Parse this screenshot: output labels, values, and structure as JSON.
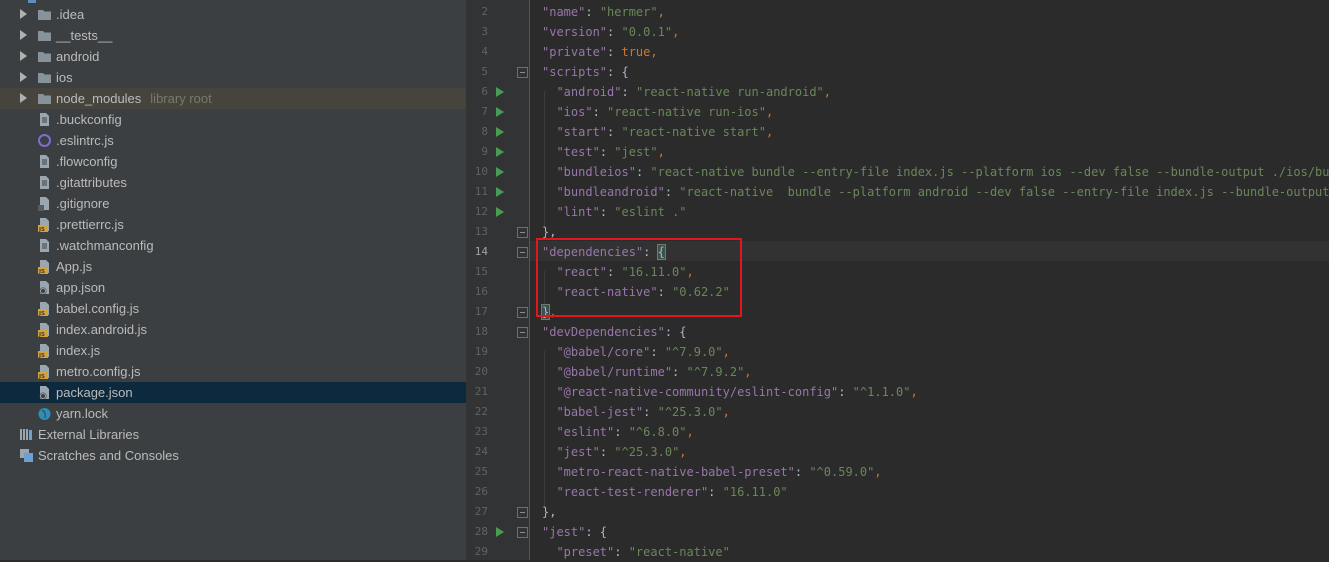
{
  "project_tree": {
    "items": [
      {
        "label": ".idea",
        "kind": "folder",
        "expandable": true
      },
      {
        "label": "__tests__",
        "kind": "folder",
        "expandable": true
      },
      {
        "label": "android",
        "kind": "folder",
        "expandable": true
      },
      {
        "label": "ios",
        "kind": "folder",
        "expandable": true
      },
      {
        "label": "node_modules",
        "hint": "library root",
        "kind": "folder",
        "expandable": true
      },
      {
        "label": ".buckconfig",
        "kind": "text-file"
      },
      {
        "label": ".eslintrc.js",
        "kind": "eslint-file"
      },
      {
        "label": ".flowconfig",
        "kind": "text-file"
      },
      {
        "label": ".gitattributes",
        "kind": "text-file"
      },
      {
        "label": ".gitignore",
        "kind": "git-file"
      },
      {
        "label": ".prettierrc.js",
        "kind": "js-file"
      },
      {
        "label": ".watchmanconfig",
        "kind": "text-file"
      },
      {
        "label": "App.js",
        "kind": "js-file"
      },
      {
        "label": "app.json",
        "kind": "json-file"
      },
      {
        "label": "babel.config.js",
        "kind": "js-file"
      },
      {
        "label": "index.android.js",
        "kind": "js-file"
      },
      {
        "label": "index.js",
        "kind": "js-file"
      },
      {
        "label": "metro.config.js",
        "kind": "js-file"
      },
      {
        "label": "package.json",
        "kind": "json-file",
        "selected": true
      },
      {
        "label": "yarn.lock",
        "kind": "yarn-file"
      }
    ],
    "external_libraries": "External Libraries",
    "scratches": "Scratches and Consoles"
  },
  "editor": {
    "current_line": 14,
    "lines": [
      {
        "n": "2",
        "t": [
          [
            "p",
            "\"name\""
          ],
          [
            "",
            ": "
          ],
          [
            "s",
            "\"hermer\""
          ],
          [
            "k",
            ","
          ]
        ]
      },
      {
        "n": "3",
        "t": [
          [
            "p",
            "\"version\""
          ],
          [
            "",
            ": "
          ],
          [
            "s",
            "\"0.0.1\""
          ],
          [
            "k",
            ","
          ]
        ]
      },
      {
        "n": "4",
        "t": [
          [
            "p",
            "\"private\""
          ],
          [
            "",
            ": "
          ],
          [
            "k",
            "true,"
          ]
        ]
      },
      {
        "n": "5",
        "t": [
          [
            "p",
            "\"scripts\""
          ],
          [
            "",
            ": {"
          ]
        ]
      },
      {
        "n": "6",
        "t": [
          [
            "",
            "  "
          ],
          [
            "p",
            "\"android\""
          ],
          [
            "",
            ": "
          ],
          [
            "s",
            "\"react-native run-android\""
          ],
          [
            "k",
            ","
          ]
        ]
      },
      {
        "n": "7",
        "t": [
          [
            "",
            "  "
          ],
          [
            "p",
            "\"ios\""
          ],
          [
            "",
            ": "
          ],
          [
            "s",
            "\"react-native run-ios\""
          ],
          [
            "k",
            ","
          ]
        ]
      },
      {
        "n": "8",
        "t": [
          [
            "",
            "  "
          ],
          [
            "p",
            "\"start\""
          ],
          [
            "",
            ": "
          ],
          [
            "s",
            "\"react-native start\""
          ],
          [
            "k",
            ","
          ]
        ]
      },
      {
        "n": "9",
        "t": [
          [
            "",
            "  "
          ],
          [
            "p",
            "\"test\""
          ],
          [
            "",
            ": "
          ],
          [
            "s",
            "\"jest\""
          ],
          [
            "k",
            ","
          ]
        ]
      },
      {
        "n": "10",
        "t": [
          [
            "",
            "  "
          ],
          [
            "p",
            "\"bundleios\""
          ],
          [
            "",
            ": "
          ],
          [
            "s",
            "\"react-native bundle --entry-file index.js --platform ios --dev false --bundle-output ./ios/bundle"
          ]
        ]
      },
      {
        "n": "11",
        "t": [
          [
            "",
            "  "
          ],
          [
            "p",
            "\"bundleandroid\""
          ],
          [
            "",
            ": "
          ],
          [
            "s",
            "\"react-native  bundle --platform android --dev false --entry-file index.js --bundle-output ./a"
          ]
        ]
      },
      {
        "n": "12",
        "t": [
          [
            "",
            "  "
          ],
          [
            "p",
            "\"lint\""
          ],
          [
            "",
            ": "
          ],
          [
            "s",
            "\"eslint .\""
          ]
        ]
      },
      {
        "n": "13",
        "t": [
          [
            "",
            "},"
          ]
        ]
      },
      {
        "n": "14",
        "t": [
          [
            "p",
            "\"dependencies\""
          ],
          [
            "",
            ": "
          ],
          [
            "hl",
            "{"
          ]
        ]
      },
      {
        "n": "15",
        "t": [
          [
            "",
            "  "
          ],
          [
            "p",
            "\"react\""
          ],
          [
            "",
            ": "
          ],
          [
            "s",
            "\"16.11.0\""
          ],
          [
            "k",
            ","
          ]
        ]
      },
      {
        "n": "16",
        "t": [
          [
            "",
            "  "
          ],
          [
            "p",
            "\"react-native\""
          ],
          [
            "",
            ": "
          ],
          [
            "s",
            "\"0.62.2\""
          ]
        ]
      },
      {
        "n": "17",
        "t": [
          [
            "hl",
            "}"
          ],
          [
            "k",
            ","
          ]
        ]
      },
      {
        "n": "18",
        "t": [
          [
            "p",
            "\"devDependencies\""
          ],
          [
            "",
            ": {"
          ]
        ]
      },
      {
        "n": "19",
        "t": [
          [
            "",
            "  "
          ],
          [
            "p",
            "\"@babel/core\""
          ],
          [
            "",
            ": "
          ],
          [
            "s",
            "\"^7.9.0\""
          ],
          [
            "k",
            ","
          ]
        ]
      },
      {
        "n": "20",
        "t": [
          [
            "",
            "  "
          ],
          [
            "p",
            "\"@babel/runtime\""
          ],
          [
            "",
            ": "
          ],
          [
            "s",
            "\"^7.9.2\""
          ],
          [
            "k",
            ","
          ]
        ]
      },
      {
        "n": "21",
        "t": [
          [
            "",
            "  "
          ],
          [
            "p",
            "\"@react-native-community/eslint-config\""
          ],
          [
            "",
            ": "
          ],
          [
            "s",
            "\"^1.1.0\""
          ],
          [
            "k",
            ","
          ]
        ]
      },
      {
        "n": "22",
        "t": [
          [
            "",
            "  "
          ],
          [
            "p",
            "\"babel-jest\""
          ],
          [
            "",
            ": "
          ],
          [
            "s",
            "\"^25.3.0\""
          ],
          [
            "k",
            ","
          ]
        ]
      },
      {
        "n": "23",
        "t": [
          [
            "",
            "  "
          ],
          [
            "p",
            "\"eslint\""
          ],
          [
            "",
            ": "
          ],
          [
            "s",
            "\"^6.8.0\""
          ],
          [
            "k",
            ","
          ]
        ]
      },
      {
        "n": "24",
        "t": [
          [
            "",
            "  "
          ],
          [
            "p",
            "\"jest\""
          ],
          [
            "",
            ": "
          ],
          [
            "s",
            "\"^25.3.0\""
          ],
          [
            "k",
            ","
          ]
        ]
      },
      {
        "n": "25",
        "t": [
          [
            "",
            "  "
          ],
          [
            "p",
            "\"metro-react-native-babel-preset\""
          ],
          [
            "",
            ": "
          ],
          [
            "s",
            "\"^0.59.0\""
          ],
          [
            "k",
            ","
          ]
        ]
      },
      {
        "n": "26",
        "t": [
          [
            "",
            "  "
          ],
          [
            "p",
            "\"react-test-renderer\""
          ],
          [
            "",
            ": "
          ],
          [
            "s",
            "\"16.11.0\""
          ]
        ]
      },
      {
        "n": "27",
        "t": [
          [
            "",
            "},"
          ]
        ]
      },
      {
        "n": "28",
        "t": [
          [
            "p",
            "\"jest\""
          ],
          [
            "",
            ": {"
          ]
        ]
      },
      {
        "n": "29",
        "t": [
          [
            "",
            "  "
          ],
          [
            "p",
            "\"preset\""
          ],
          [
            "",
            ": "
          ],
          [
            "s",
            "\"react-native\""
          ]
        ]
      }
    ],
    "run_lines": [
      6,
      7,
      8,
      9,
      10,
      11,
      12,
      28
    ],
    "fold_lines": [
      5,
      13,
      14,
      17,
      18,
      27,
      28
    ]
  }
}
